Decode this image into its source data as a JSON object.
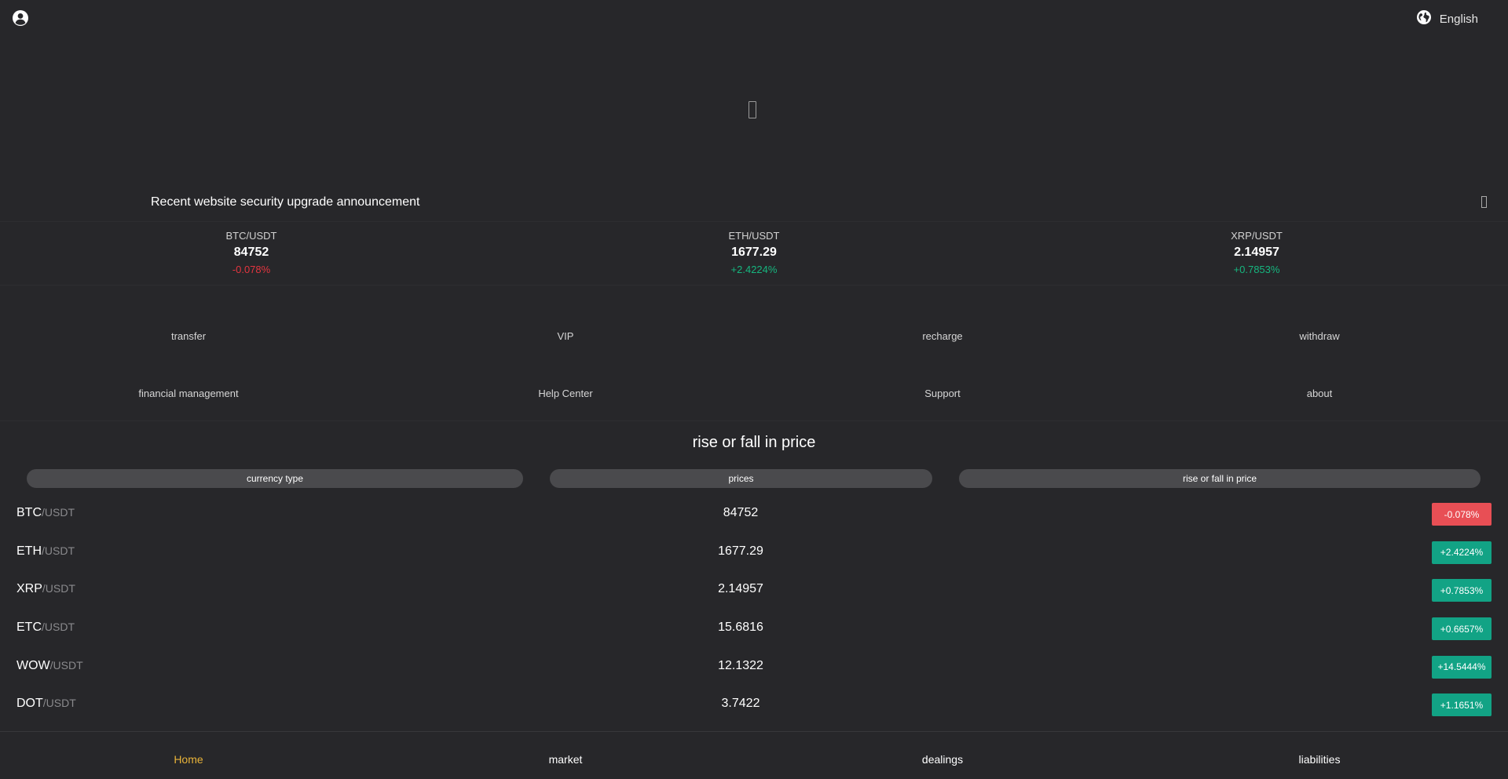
{
  "header": {
    "language_label": "English",
    "icons": {
      "user": "user-circle-icon",
      "language": "globe-icon"
    }
  },
  "banner": {
    "icon": "broken-image-icon"
  },
  "notice": {
    "text": "Recent website security upgrade announcement",
    "icon": "more-icon"
  },
  "tickers": [
    {
      "pair": "BTC/USDT",
      "price": "84752",
      "change": "-0.078%",
      "direction": "down"
    },
    {
      "pair": "ETH/USDT",
      "price": "1677.29",
      "change": "+2.4224%",
      "direction": "up"
    },
    {
      "pair": "XRP/USDT",
      "price": "2.14957",
      "change": "+0.7853%",
      "direction": "up"
    }
  ],
  "quick_menu": [
    {
      "label": "transfer"
    },
    {
      "label": "VIP"
    },
    {
      "label": "recharge"
    },
    {
      "label": "withdraw"
    },
    {
      "label": "financial management"
    },
    {
      "label": "Help Center"
    },
    {
      "label": "Support"
    },
    {
      "label": "about"
    }
  ],
  "market": {
    "title": "rise or fall in price",
    "columns": [
      "currency type",
      "prices",
      "rise or fall in price"
    ],
    "rows": [
      {
        "base": "BTC",
        "quote": "/USDT",
        "price": "84752",
        "change": "-0.078%",
        "direction": "down"
      },
      {
        "base": "ETH",
        "quote": "/USDT",
        "price": "1677.29",
        "change": "+2.4224%",
        "direction": "up"
      },
      {
        "base": "XRP",
        "quote": "/USDT",
        "price": "2.14957",
        "change": "+0.7853%",
        "direction": "up"
      },
      {
        "base": "ETC",
        "quote": "/USDT",
        "price": "15.6816",
        "change": "+0.6657%",
        "direction": "up"
      },
      {
        "base": "WOW",
        "quote": "/USDT",
        "price": "12.1322",
        "change": "+14.5444%",
        "direction": "up"
      },
      {
        "base": "DOT",
        "quote": "/USDT",
        "price": "3.7422",
        "change": "+1.1651%",
        "direction": "up"
      }
    ]
  },
  "bottom_nav": [
    {
      "label": "Home",
      "active": true
    },
    {
      "label": "market",
      "active": false
    },
    {
      "label": "dealings",
      "active": false
    },
    {
      "label": "liabilities",
      "active": false
    }
  ],
  "colors": {
    "background": "#27272a",
    "up": "#12a385",
    "down": "#e84f55",
    "active_nav": "#e8b339"
  }
}
